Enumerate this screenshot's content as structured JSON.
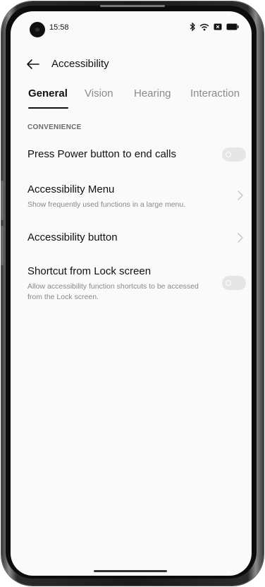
{
  "status_bar": {
    "time": "15:58",
    "icons": [
      "bluetooth-icon",
      "wifi-icon",
      "sim-icon",
      "battery-icon"
    ]
  },
  "header": {
    "back_icon": "arrow-left-icon",
    "title": "Accessibility"
  },
  "tabs": [
    {
      "label": "General",
      "active": true
    },
    {
      "label": "Vision",
      "active": false
    },
    {
      "label": "Hearing",
      "active": false
    },
    {
      "label": "Interaction",
      "active": false
    }
  ],
  "section": {
    "header": "CONVENIENCE",
    "items": [
      {
        "title": "Press Power button to end calls",
        "subtitle": "",
        "control": "toggle",
        "on": false
      },
      {
        "title": "Accessibility Menu",
        "subtitle": "Show frequently used functions in a large menu.",
        "control": "chevron"
      },
      {
        "title": "Accessibility button",
        "subtitle": "",
        "control": "chevron"
      },
      {
        "title": "Shortcut from Lock screen",
        "subtitle": "Allow accessibility function shortcuts to be accessed from the Lock screen.",
        "control": "toggle",
        "on": false
      }
    ]
  },
  "colors": {
    "screen_bg": "#fafafa",
    "text_primary": "#111111",
    "text_secondary": "#888888",
    "tab_inactive": "#8a8a8a",
    "toggle_off": "#e6e6e6"
  }
}
